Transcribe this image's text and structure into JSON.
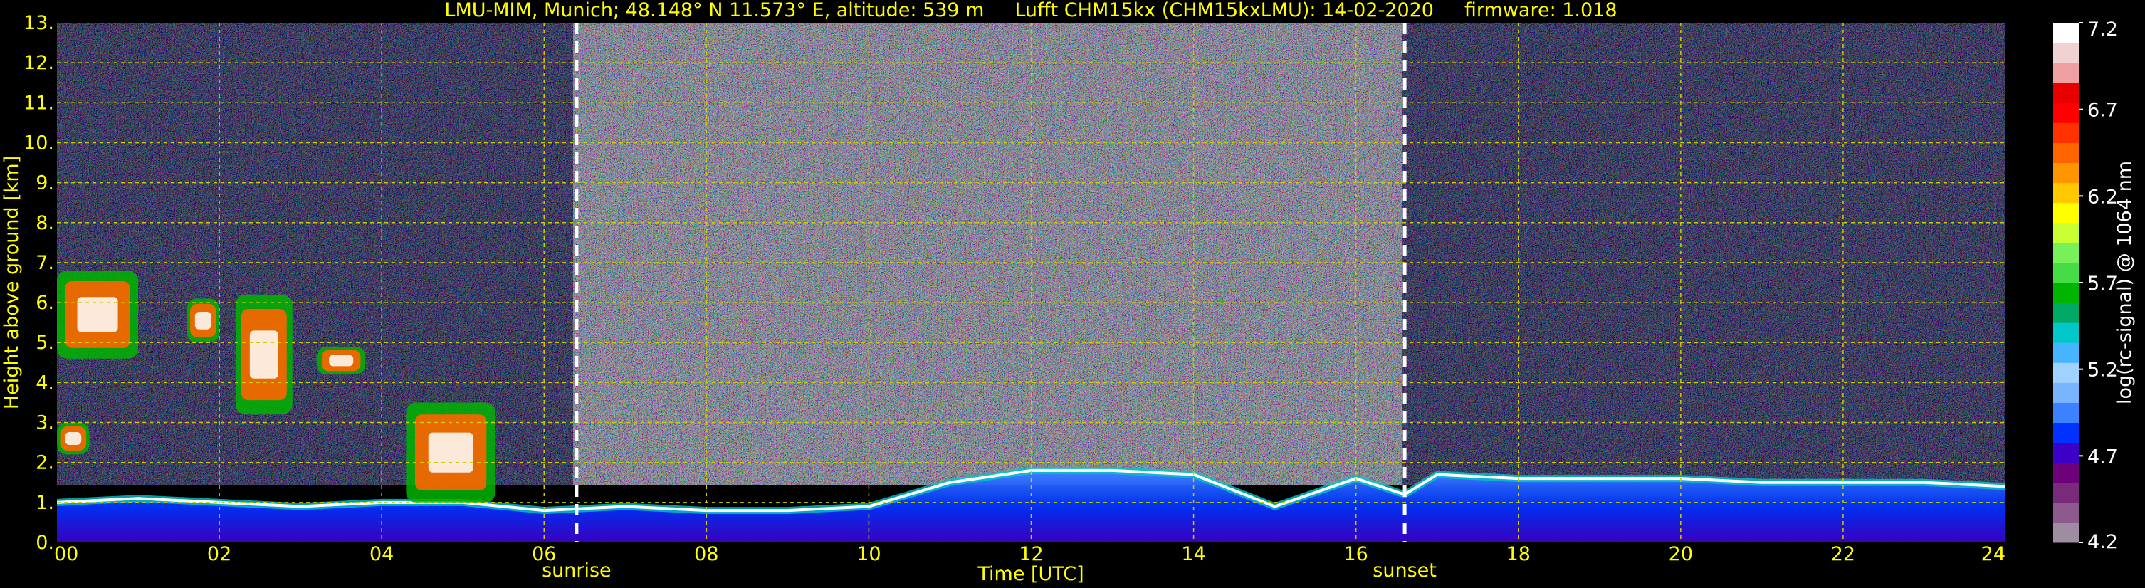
{
  "chart_data": {
    "type": "heatmap",
    "title": "LMU-MIM, Munich; 48.148° N 11.573° E, altitude: 539 m     Lufft CHM15kx (CHM15kxLMU): 14-02-2020     firmware: 1.018",
    "xlabel": "Time [UTC]",
    "ylabel": "Height above ground [km]",
    "colorbar_label": "log(rc-signal) @ 1064 nm",
    "x_range": [
      0,
      24
    ],
    "y_range": [
      0,
      13
    ],
    "x_ticks": [
      "00",
      "02",
      "04",
      "06",
      "08",
      "10",
      "12",
      "14",
      "16",
      "18",
      "20",
      "22",
      "24"
    ],
    "y_ticks": [
      "0.",
      "1.",
      "2.",
      "3.",
      "4.",
      "5.",
      "6.",
      "7.",
      "8.",
      "9.",
      "10.",
      "11.",
      "12.",
      "13."
    ],
    "colorbar_ticks": [
      "4.2",
      "4.7",
      "5.2",
      "5.7",
      "6.2",
      "6.7",
      "7.2"
    ],
    "colorbar_range": [
      4.2,
      7.2
    ],
    "grid": true,
    "markers": [
      {
        "label": "sunrise",
        "time": 6.4
      },
      {
        "label": "sunset",
        "time": 16.6
      }
    ],
    "colors": {
      "text": "#ffff00",
      "grid": "#cccc00",
      "background": "#000000",
      "colorbar": [
        "#a08ca0",
        "#8c5a8c",
        "#7a2a7a",
        "#6e007a",
        "#3c00c8",
        "#0032ff",
        "#3c82ff",
        "#78b4ff",
        "#a0d2ff",
        "#46b4ff",
        "#00c8c8",
        "#00aa64",
        "#00b400",
        "#46dc46",
        "#78f05a",
        "#c8ff32",
        "#ffff00",
        "#ffc800",
        "#ff9600",
        "#ff6400",
        "#ff3200",
        "#ff0000",
        "#e80000",
        "#f0a0a0",
        "#f0d2d2",
        "#ffffff"
      ]
    },
    "features": {
      "boundary_layer_top_km": [
        [
          0.0,
          1.0
        ],
        [
          1.0,
          1.1
        ],
        [
          2.0,
          1.0
        ],
        [
          3.0,
          0.9
        ],
        [
          4.0,
          1.0
        ],
        [
          5.0,
          1.0
        ],
        [
          6.0,
          0.8
        ],
        [
          7.0,
          0.9
        ],
        [
          8.0,
          0.8
        ],
        [
          9.0,
          0.8
        ],
        [
          10.0,
          0.9
        ],
        [
          11.0,
          1.5
        ],
        [
          12.0,
          1.8
        ],
        [
          13.0,
          1.8
        ],
        [
          14.0,
          1.7
        ],
        [
          15.0,
          0.9
        ],
        [
          16.0,
          1.6
        ],
        [
          16.6,
          1.2
        ],
        [
          17.0,
          1.7
        ],
        [
          18.0,
          1.6
        ],
        [
          19.0,
          1.6
        ],
        [
          20.0,
          1.6
        ],
        [
          21.0,
          1.5
        ],
        [
          22.0,
          1.5
        ],
        [
          23.0,
          1.5
        ],
        [
          24.0,
          1.4
        ]
      ],
      "cloud_patches": [
        {
          "t0": 0.0,
          "t1": 1.0,
          "h0": 4.6,
          "h1": 6.8
        },
        {
          "t0": 1.6,
          "t1": 2.0,
          "h0": 5.0,
          "h1": 6.1
        },
        {
          "t0": 2.2,
          "t1": 2.9,
          "h0": 3.2,
          "h1": 6.2
        },
        {
          "t0": 3.2,
          "t1": 3.8,
          "h0": 4.2,
          "h1": 4.9
        },
        {
          "t0": 0.0,
          "t1": 0.4,
          "h0": 2.2,
          "h1": 3.0
        },
        {
          "t0": 4.3,
          "t1": 5.4,
          "h0": 1.0,
          "h1": 3.5
        }
      ]
    }
  }
}
